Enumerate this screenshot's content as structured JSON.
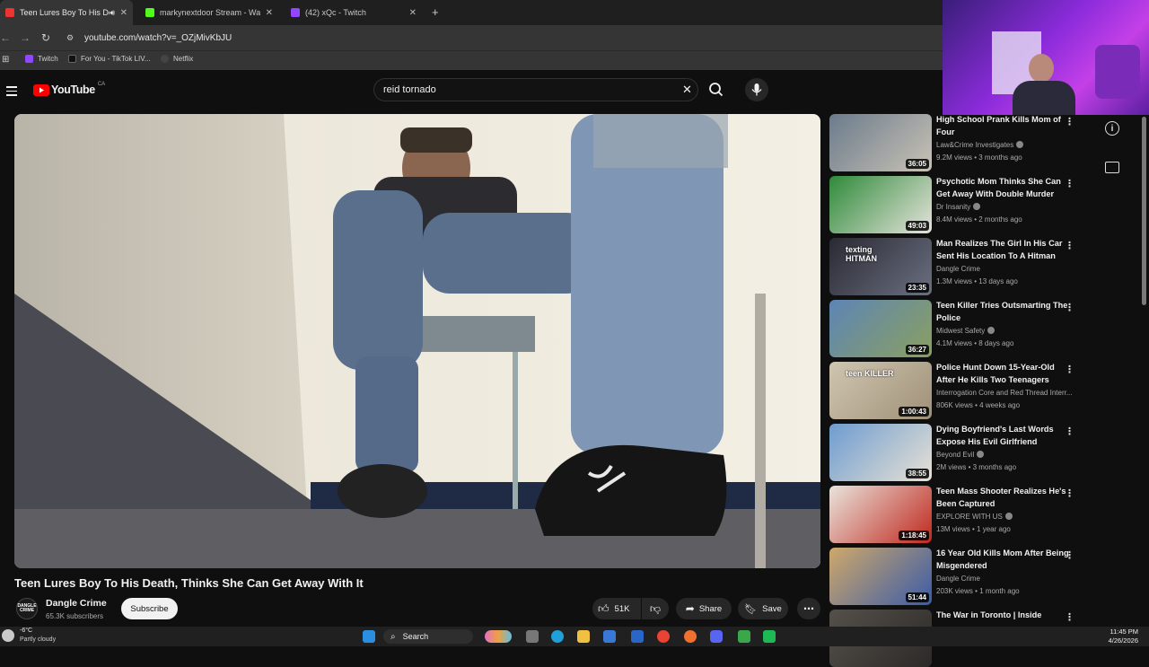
{
  "tabs": [
    {
      "label": "Teen Lures Boy To His Death",
      "color": "#e33"
    },
    {
      "label": "markynextdoor Stream - Watch",
      "color": "#53fc18"
    },
    {
      "label": "(42) xQc - Twitch",
      "color": "#9146ff"
    }
  ],
  "address": {
    "url": "youtube.com/watch?v=_OZjMivKbJU"
  },
  "bookmarks": [
    {
      "label": "Twitch"
    },
    {
      "label": "For You - TikTok LIV..."
    },
    {
      "label": "Netflix"
    }
  ],
  "youtube": {
    "logo_text": "YouTube",
    "region": "CA",
    "search_value": "reid tornado"
  },
  "video": {
    "title": "Teen Lures Boy To His Death, Thinks She Can Get Away With It",
    "channel": "Dangle Crime",
    "subscribers": "65.3K subscribers",
    "subscribe_label": "Subscribe",
    "likes": "51K",
    "share_label": "Share",
    "save_label": "Save"
  },
  "recommendations": [
    {
      "title": "High School Prank Kills Mom of Four",
      "channel": "Law&Crime Investigates",
      "verified": true,
      "meta": "9.2M views • 3 months ago",
      "duration": "36:05",
      "thumb": [
        "#6b7b8c",
        "#c9c3b5"
      ]
    },
    {
      "title": "Psychotic Mom Thinks She Can Get Away With Double Murder",
      "channel": "Dr Insanity",
      "verified": true,
      "meta": "8.4M views • 2 months ago",
      "duration": "49:03",
      "thumb": [
        "#2f8a3a",
        "#e7e3dc"
      ]
    },
    {
      "title": "Man Realizes The Girl In His Car Sent His Location To A Hitman",
      "channel": "Dangle Crime",
      "verified": false,
      "meta": "1.3M views • 13 days ago",
      "duration": "23:35",
      "thumb": [
        "#2a2a33",
        "#6a6f80"
      ],
      "thumb_text": "texting HITMAN"
    },
    {
      "title": "Teen Killer Tries Outsmarting The Police",
      "channel": "Midwest Safety",
      "verified": true,
      "meta": "4.1M views • 8 days ago",
      "duration": "36:27",
      "thumb": [
        "#5d85b5",
        "#8aa060"
      ]
    },
    {
      "title": "Police Hunt Down 15-Year-Old After He Kills Two Teenagers",
      "channel": "Interrogation Core and Red Thread Interr...",
      "verified": false,
      "meta": "806K views • 4 weeks ago",
      "duration": "1:00:43",
      "thumb": [
        "#cfc6b0",
        "#a09078"
      ],
      "thumb_text": "teen KILLER"
    },
    {
      "title": "Dying Boyfriend's Last Words Expose His Evil Girlfriend",
      "channel": "Beyond Evil",
      "verified": true,
      "meta": "2M views • 3 months ago",
      "duration": "38:55",
      "thumb": [
        "#6e9cd0",
        "#e8e2d4"
      ]
    },
    {
      "title": "Teen Mass Shooter Realizes He's Been Captured",
      "channel": "EXPLORE WITH US",
      "verified": true,
      "meta": "13M views • 1 year ago",
      "duration": "1:18:45",
      "thumb": [
        "#e9e4dc",
        "#c0281e"
      ]
    },
    {
      "title": "16 Year Old Kills Mom After Being Misgendered",
      "channel": "Dangle Crime",
      "verified": false,
      "meta": "203K views • 1 month ago",
      "duration": "51:44",
      "thumb": [
        "#cfa86a",
        "#3a5ca8"
      ]
    },
    {
      "title": "The War in Toronto | Inside",
      "channel": "",
      "verified": false,
      "meta": "",
      "duration": "",
      "thumb": [
        "#55504a",
        "#2c2a28"
      ]
    }
  ],
  "taskbar": {
    "temperature": "-6°C",
    "weather": "Partly cloudy",
    "search_label": "Search",
    "time": "11:45 PM",
    "date": "4/26/2026"
  }
}
